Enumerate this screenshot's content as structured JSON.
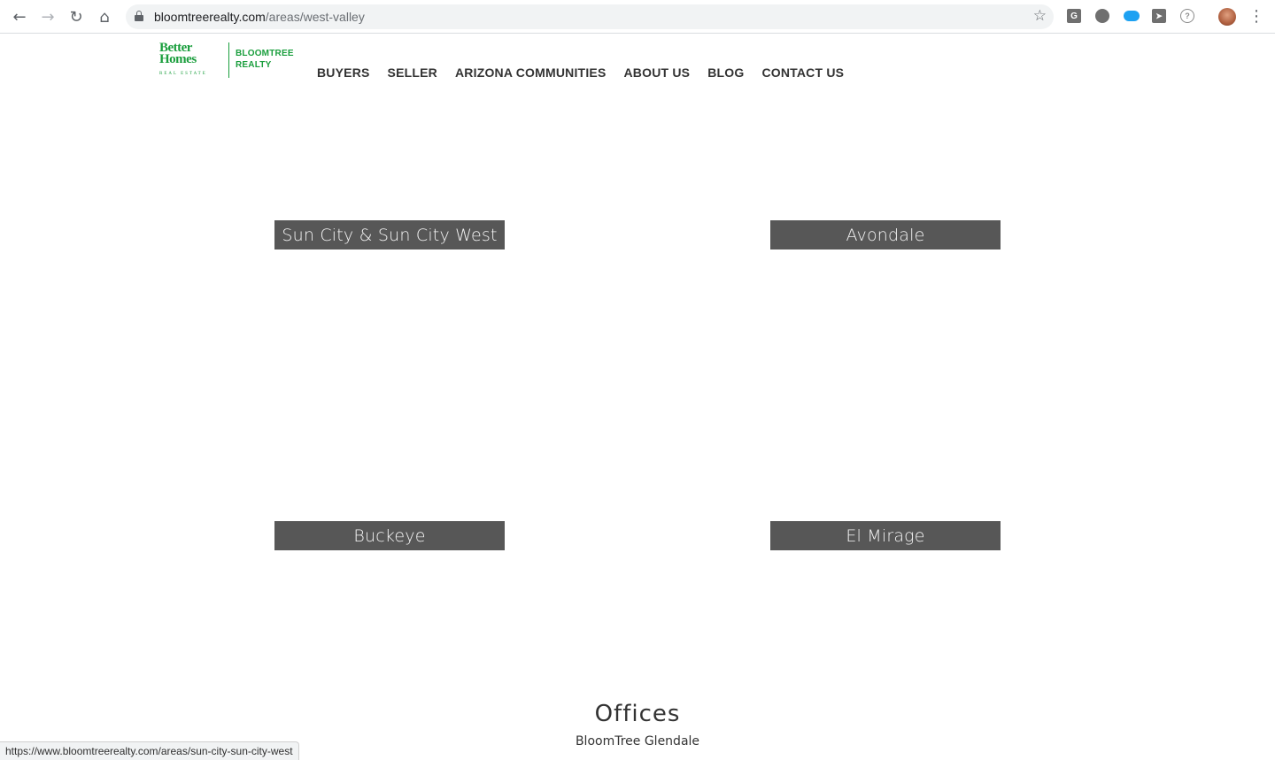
{
  "browser": {
    "url_domain": "bloomtreerealty.com",
    "url_path": "/areas/west-valley",
    "status_url": "https://www.bloomtreerealty.com/areas/sun-city-sun-city-west",
    "extensions": [
      "G"
    ]
  },
  "logo": {
    "bhg_line1": "Better",
    "bhg_line2": "Homes",
    "bhg_line3": "REAL ESTATE",
    "brand_line1": "BLOOMTREE",
    "brand_line2": "REALTY"
  },
  "nav": {
    "items": [
      "BUYERS",
      "SELLER",
      "ARIZONA COMMUNITIES",
      "ABOUT US",
      "BLOG",
      "CONTACT US"
    ]
  },
  "areas": [
    "Sun City & Sun City West",
    "Avondale",
    "Buckeye",
    "El Mirage"
  ],
  "offices": {
    "title": "Offices",
    "first": "BloomTree Glendale"
  },
  "colors": {
    "brand_green": "#1a9e3d",
    "area_button_bg": "#575757"
  }
}
